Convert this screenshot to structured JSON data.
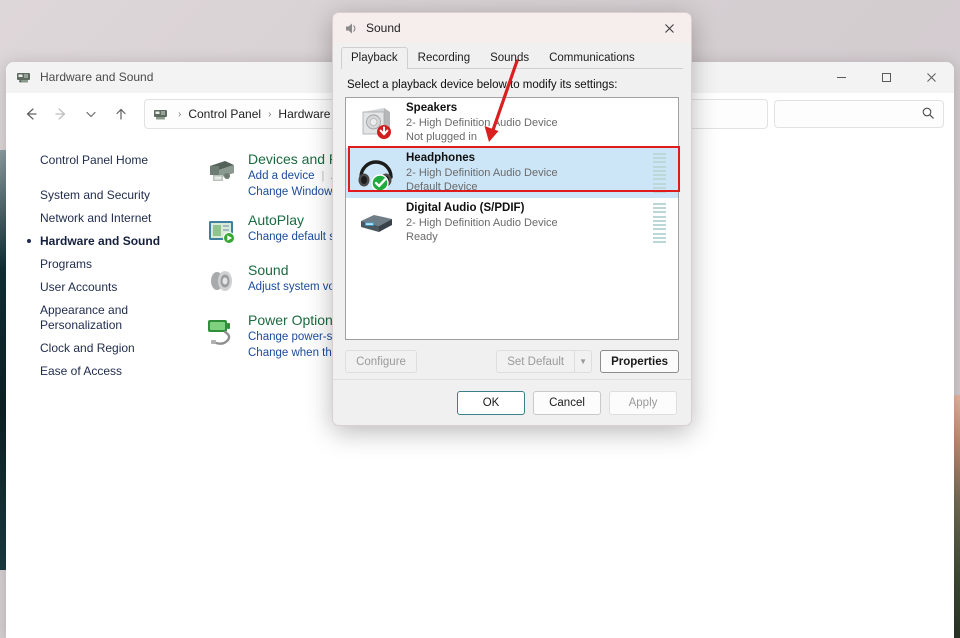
{
  "control_panel": {
    "title": "Hardware and Sound",
    "title_icon": "control-panel-icon",
    "window_controls": {
      "minimize": "–",
      "maximize": "☐",
      "close": "✕"
    },
    "nav_buttons": {
      "back": "←",
      "forward": "→",
      "recent": "⌄",
      "up": "↑"
    },
    "breadcrumb": {
      "icon": "control-panel-icon",
      "items": [
        "Control Panel",
        "Hardware and S"
      ],
      "separator": "›"
    },
    "search": {
      "icon": "search-icon",
      "placeholder": ""
    },
    "sidebar": {
      "items": [
        {
          "label": "Control Panel Home",
          "current": false
        },
        {
          "label": "System and Security",
          "current": false
        },
        {
          "label": "Network and Internet",
          "current": false
        },
        {
          "label": "Hardware and Sound",
          "current": true
        },
        {
          "label": "Programs",
          "current": false
        },
        {
          "label": "User Accounts",
          "current": false
        },
        {
          "label": "Appearance and Personalization",
          "current": false
        },
        {
          "label": "Clock and Region",
          "current": false
        },
        {
          "label": "Ease of Access",
          "current": false
        }
      ]
    },
    "categories": [
      {
        "icon": "printer-icon",
        "title": "Devices and Pr",
        "links": [
          "Add a device",
          "A"
        ],
        "sublinks": [
          "Change Windows T"
        ]
      },
      {
        "icon": "autoplay-icon",
        "title": "AutoPlay",
        "links": [],
        "sublinks": [
          "Change default set"
        ]
      },
      {
        "icon": "sound-speaker-icon",
        "title": "Sound",
        "links": [],
        "sublinks": [
          "Adjust system volu"
        ]
      },
      {
        "icon": "battery-icon",
        "title": "Power Options",
        "links": [],
        "sublinks": [
          "Change power-sav",
          "Change when the c"
        ]
      }
    ]
  },
  "sound_dialog": {
    "title": "Sound",
    "title_icon": "sound-icon",
    "close_label": "✕",
    "tabs": [
      {
        "label": "Playback",
        "active": true
      },
      {
        "label": "Recording",
        "active": false
      },
      {
        "label": "Sounds",
        "active": false
      },
      {
        "label": "Communications",
        "active": false
      }
    ],
    "prompt": "Select a playback device below to modify its settings:",
    "devices": [
      {
        "icon": "speaker-device-icon",
        "badge": "down-arrow-badge",
        "name": "Speakers",
        "description": "2- High Definition Audio Device",
        "status": "Not plugged in",
        "selected": false,
        "show_meter": false
      },
      {
        "icon": "headphones-device-icon",
        "badge": "green-check-badge",
        "name": "Headphones",
        "description": "2- High Definition Audio Device",
        "status": "Default Device",
        "selected": true,
        "show_meter": true
      },
      {
        "icon": "spdif-device-icon",
        "badge": "",
        "name": "Digital Audio (S/PDIF)",
        "description": "2- High Definition Audio Device",
        "status": "Ready",
        "selected": false,
        "show_meter": true
      }
    ],
    "actions": {
      "configure": "Configure",
      "set_default": "Set Default",
      "set_default_arrow": "▼",
      "properties": "Properties"
    },
    "footer": {
      "ok": "OK",
      "cancel": "Cancel",
      "apply": "Apply"
    }
  },
  "annotations": {
    "highlight_color": "#e01b1b",
    "arrow_color": "#d91f1f",
    "highlight_target": "Headphones",
    "arrow_target": "Headphones"
  }
}
